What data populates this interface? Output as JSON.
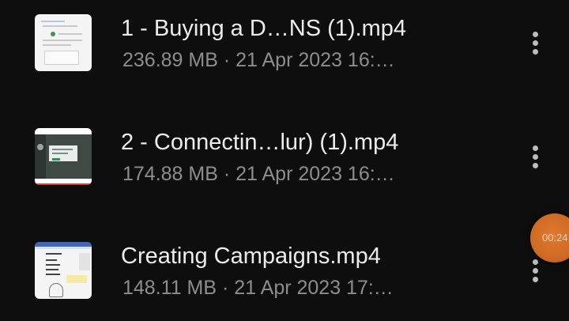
{
  "files": [
    {
      "name": "1 - Buying a D…NS (1).mp4",
      "meta": "236.89 MB · 21 Apr 2023 16:…"
    },
    {
      "name": "2 - Connectin…lur) (1).mp4",
      "meta": "174.88 MB · 21 Apr 2023 16:…"
    },
    {
      "name": "Creating Campaigns.mp4",
      "meta": "148.11 MB · 21 Apr 2023 17:…"
    }
  ],
  "timer": {
    "text": "00:24"
  },
  "icons": {
    "more": "more-vertical-icon",
    "thumbnail": "video-thumbnail-icon"
  },
  "colors": {
    "background": "#0e0e0e",
    "title": "#ececec",
    "meta": "#8d8d8d",
    "timer": "#cd6a25"
  }
}
